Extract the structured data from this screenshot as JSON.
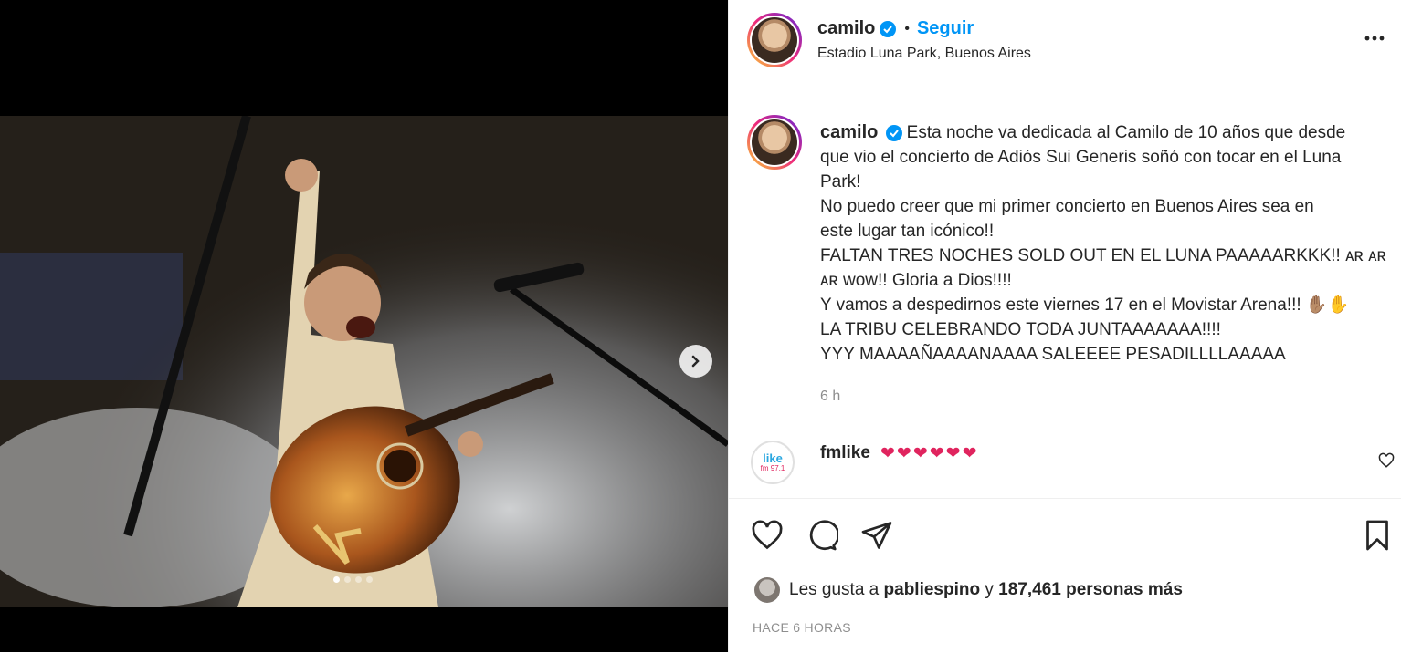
{
  "post": {
    "username": "camilo",
    "separator": "•",
    "follow_label": "Seguir",
    "location": "Estadio Luna Park, Buenos Aires",
    "caption_lines": [
      "Esta noche va dedicada al Camilo de 10 años que desde",
      "que vio el concierto de Adiós Sui Generis soñó con tocar en el Luna",
      "Park!",
      "No puedo creer que mi primer concierto en Buenos Aires sea en",
      "este lugar tan icónico!!",
      "FALTAN TRES NOCHES SOLD OUT EN EL LUNA PAAAAARKKK!! ᴀʀ ᴀʀ",
      "ᴀʀ wow!! Gloria a Dios!!!!",
      "Y vamos a despedirnos este viernes 17 en el Movistar Arena!!! ✋🏽✋",
      "LA TRIBU CELEBRANDO TODA JUNTAAAAAAA!!!!",
      "YYY MAAAAÑAAAANAAAA SALEEEE PESADILLLLAAAAA"
    ],
    "time": "6 h",
    "likes_prefix": "Les gusta a",
    "likes_user": "pabliespino",
    "likes_mid": "y",
    "likes_count": "187,461 personas más",
    "ago": "HACE 6 HORAS",
    "carousel_total": 4,
    "carousel_active": 1
  },
  "comment": {
    "username": "fmlike",
    "text": "❤❤❤❤❤❤",
    "logo_top": "like",
    "logo_bottom": "fm 97.1"
  },
  "icons": {
    "verified": "verified-badge-icon",
    "more": "more-options-icon",
    "next": "chevron-right-icon",
    "like": "heart-icon",
    "comment": "comment-icon",
    "share": "send-icon",
    "save": "bookmark-icon"
  },
  "colors": {
    "accent": "#0095f6",
    "muted": "#8e8e8e",
    "text": "#262626"
  }
}
